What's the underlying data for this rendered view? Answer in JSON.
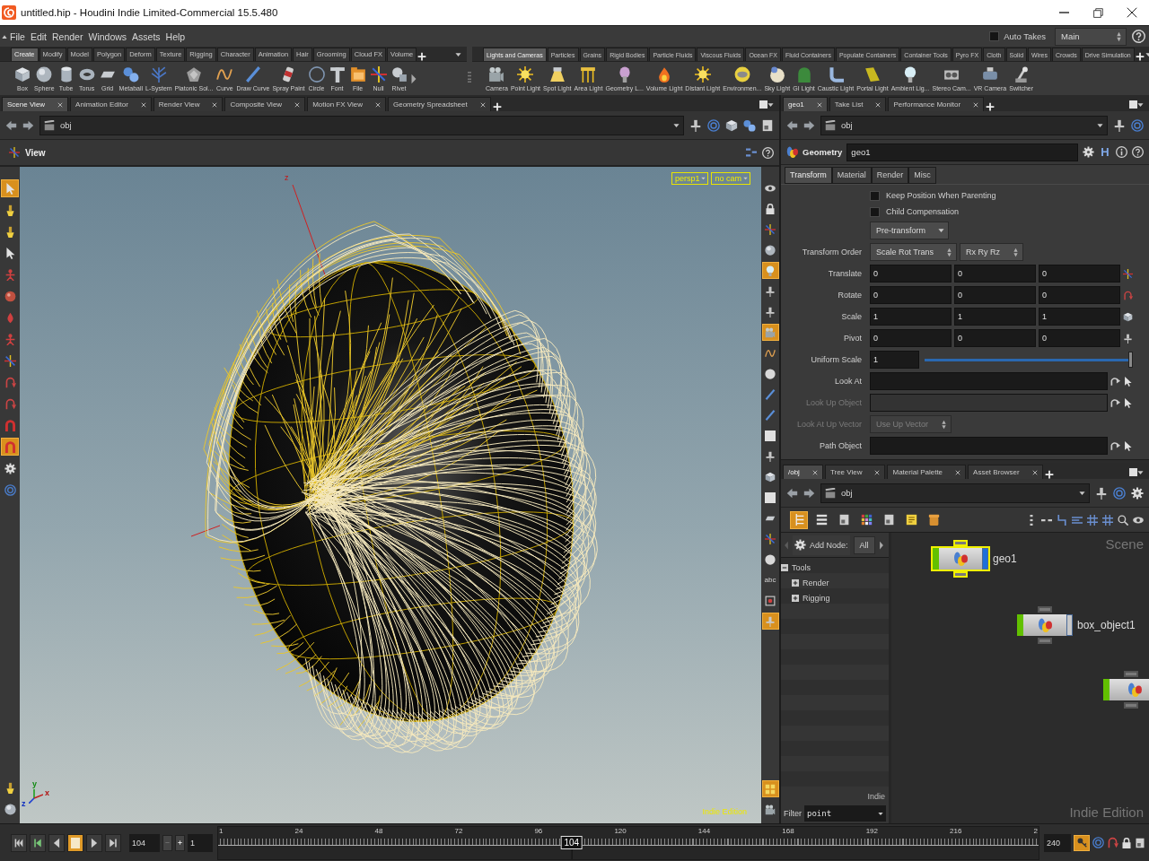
{
  "title_bar": {
    "title": "untitled.hip - Houdini Indie Limited-Commercial 15.5.480"
  },
  "menu_bar": {
    "items": [
      "File",
      "Edit",
      "Render",
      "Windows",
      "Assets",
      "Help"
    ],
    "auto_takes": {
      "label": "Auto Takes",
      "checked": false
    },
    "take": "Main"
  },
  "shelves": [
    {
      "tabs": [
        {
          "label": "Create",
          "selected": true
        },
        {
          "label": "Modify",
          "selected": false
        },
        {
          "label": "Model",
          "selected": false
        },
        {
          "label": "Polygon",
          "selected": false
        },
        {
          "label": "Deform",
          "selected": false
        },
        {
          "label": "Texture",
          "selected": false
        },
        {
          "label": "Rigging",
          "selected": false
        },
        {
          "label": "Character",
          "selected": false
        },
        {
          "label": "Animation",
          "selected": false
        },
        {
          "label": "Hair",
          "selected": false
        },
        {
          "label": "Grooming",
          "selected": false
        },
        {
          "label": "Cloud FX",
          "selected": false
        },
        {
          "label": "Volume",
          "selected": false
        }
      ],
      "tools": [
        "Box",
        "Sphere",
        "Tube",
        "Torus",
        "Grid",
        "Metaball",
        "L-System",
        "Platonic Sol...",
        "Curve",
        "Draw Curve",
        "Spray Paint",
        "Circle",
        "Font",
        "File",
        "Null",
        "Rivet"
      ]
    },
    {
      "tabs": [
        {
          "label": "Lights and Cameras",
          "selected": true
        },
        {
          "label": "Particles",
          "selected": false
        },
        {
          "label": "Grains",
          "selected": false
        },
        {
          "label": "Rigid Bodies",
          "selected": false
        },
        {
          "label": "Particle Fluids",
          "selected": false
        },
        {
          "label": "Viscous Fluids",
          "selected": false
        },
        {
          "label": "Ocean FX",
          "selected": false
        },
        {
          "label": "Fluid Containers",
          "selected": false
        },
        {
          "label": "Populate Containers",
          "selected": false
        },
        {
          "label": "Container Tools",
          "selected": false
        },
        {
          "label": "Pyro FX",
          "selected": false
        },
        {
          "label": "Cloth",
          "selected": false
        },
        {
          "label": "Solid",
          "selected": false
        },
        {
          "label": "Wires",
          "selected": false
        },
        {
          "label": "Crowds",
          "selected": false
        },
        {
          "label": "Drive Simulation",
          "selected": false
        }
      ],
      "tools": [
        "Camera",
        "Point Light",
        "Spot Light",
        "Area Light",
        "Geometry L...",
        "Volume Light",
        "Distant Light",
        "Environmen...",
        "Sky Light",
        "GI Light",
        "Caustic Light",
        "Portal Light",
        "Ambient Lig...",
        "Stereo Cam...",
        "VR Camera",
        "Switcher"
      ]
    }
  ],
  "scene_pane": {
    "tabs": [
      {
        "label": "Scene View",
        "selected": true
      },
      {
        "label": "Animation Editor",
        "selected": false
      },
      {
        "label": "Render View",
        "selected": false
      },
      {
        "label": "Composite View",
        "selected": false
      },
      {
        "label": "Motion FX View",
        "selected": false
      },
      {
        "label": "Geometry Spreadsheet",
        "selected": false
      }
    ],
    "path": "obj",
    "viewer_title": "View"
  },
  "viewport": {
    "camera_menus": [
      "persp1",
      "no cam"
    ],
    "handle_labels": [
      "z"
    ],
    "axes": [
      "y",
      "x",
      "z"
    ],
    "edition_label": "Indie Edition",
    "left_tools": [
      {
        "on": true
      },
      {
        "on": false
      },
      {
        "on": false
      },
      {
        "on": false
      },
      {
        "on": false
      },
      {
        "on": false
      },
      {
        "on": false
      },
      {
        "on": false
      },
      {
        "on": false
      },
      {
        "on": false
      },
      {
        "on": false
      },
      {
        "on": false
      },
      {
        "on": true
      },
      {
        "on": false
      },
      {
        "on": false
      }
    ],
    "left_tools_bottom": [
      {
        "on": false
      },
      {
        "on": false
      }
    ],
    "right_tools": [
      {
        "kind": "icon",
        "on": false
      },
      {
        "kind": "icon",
        "on": false
      },
      {
        "kind": "icon",
        "on": false
      },
      {
        "kind": "icon",
        "on": false
      },
      {
        "kind": "icon",
        "on": true
      },
      {
        "kind": "icon",
        "on": false
      },
      {
        "kind": "icon",
        "on": false
      },
      {
        "kind": "icon",
        "on": true
      },
      {
        "kind": "icon",
        "on": false
      },
      {
        "kind": "icon",
        "on": false
      },
      {
        "kind": "icon",
        "on": false
      },
      {
        "kind": "icon",
        "on": false
      },
      {
        "kind": "icon",
        "on": false
      },
      {
        "kind": "icon",
        "on": false
      },
      {
        "kind": "icon",
        "on": false
      },
      {
        "kind": "icon",
        "on": false
      },
      {
        "kind": "icon",
        "on": false
      },
      {
        "kind": "icon",
        "on": false
      },
      {
        "kind": "icon",
        "on": false
      },
      {
        "kind": "text",
        "label": "abc",
        "on": false
      },
      {
        "kind": "icon",
        "on": false
      },
      {
        "kind": "icon",
        "on": true
      }
    ],
    "right_tools_bottom": [
      {
        "on": true
      },
      {
        "on": false
      }
    ]
  },
  "parameter_pane": {
    "tabs": [
      {
        "label": "geo1",
        "selected": true
      },
      {
        "label": "Take List",
        "selected": false
      },
      {
        "label": "Performance Monitor",
        "selected": false
      }
    ],
    "path": "obj",
    "node_type": "Geometry",
    "node_name": "geo1",
    "asset_button": "H",
    "param_tabs": [
      {
        "label": "Transform",
        "selected": true
      },
      {
        "label": "Material",
        "selected": false
      },
      {
        "label": "Render",
        "selected": false
      },
      {
        "label": "Misc",
        "selected": false
      }
    ],
    "rows": [
      {
        "kind": "checkbox",
        "label": "Keep Position When Parenting",
        "checked": false,
        "disabled": false
      },
      {
        "kind": "checkbox",
        "label": "Child Compensation",
        "checked": false,
        "disabled": false
      },
      {
        "kind": "menu",
        "options": [
          "Pre-transform"
        ],
        "disabled": false
      },
      {
        "kind": "menu",
        "label": "Transform Order",
        "options": [
          "Scale Rot Trans",
          "Rx Ry Rz"
        ],
        "disabled": false
      },
      {
        "kind": "vector",
        "label": "Translate",
        "values": [
          "0",
          "0",
          "0"
        ],
        "disabled": false
      },
      {
        "kind": "vector",
        "label": "Rotate",
        "values": [
          "0",
          "0",
          "0"
        ],
        "disabled": false
      },
      {
        "kind": "vector",
        "label": "Scale",
        "values": [
          "1",
          "1",
          "1"
        ],
        "disabled": false
      },
      {
        "kind": "vector",
        "label": "Pivot",
        "values": [
          "0",
          "0",
          "0"
        ],
        "disabled": false
      },
      {
        "kind": "slider",
        "label": "Uniform Scale",
        "value": "1",
        "level": 1,
        "disabled": false
      },
      {
        "kind": "field",
        "label": "Look At",
        "disabled": false
      },
      {
        "kind": "field",
        "label": "Look Up Object",
        "disabled": true
      },
      {
        "kind": "menu",
        "label": "Look At Up Vector",
        "options": [
          "Use Up Vector"
        ],
        "disabled": true
      },
      {
        "kind": "field",
        "label": "Path Object",
        "disabled": false
      }
    ]
  },
  "network_pane": {
    "tabs": [
      {
        "label": "/obj",
        "selected": true
      },
      {
        "label": "Tree View",
        "selected": false
      },
      {
        "label": "Material Palette",
        "selected": false
      },
      {
        "label": "Asset Browser",
        "selected": false
      }
    ],
    "path": "obj",
    "view_modes": [
      {
        "selected": true
      },
      {
        "selected": false
      },
      {
        "selected": false
      },
      {
        "selected": false
      },
      {
        "selected": false
      },
      {
        "selected": false
      },
      {
        "selected": false
      }
    ],
    "add_node": {
      "label": "Add Node:",
      "filter": "All"
    },
    "tree": [
      {
        "label": "Tools",
        "expanded": true,
        "children": [
          {
            "label": "Render",
            "expanded": false
          },
          {
            "label": "Rigging",
            "expanded": false
          }
        ]
      }
    ],
    "palette_label": "Indie",
    "filter": {
      "label": "Filter",
      "value": "point"
    },
    "context_label": "Scene",
    "edition_label": "Indie Edition",
    "nodes": [
      {
        "label": "geo1",
        "selected": true,
        "display": true
      },
      {
        "label": "box_object1",
        "selected": false,
        "display": false
      },
      {
        "selected": false
      }
    ]
  },
  "timeline": {
    "controls": [
      {
        "kind": "first",
        "selected": false
      },
      {
        "kind": "previous-key",
        "selected": false
      },
      {
        "kind": "reverse",
        "selected": false
      },
      {
        "kind": "stop",
        "selected": true
      },
      {
        "kind": "play",
        "selected": false
      },
      {
        "kind": "last",
        "selected": false
      }
    ],
    "frame": "104",
    "start": "1",
    "ticks": [
      "1",
      "24",
      "48",
      "72",
      "96",
      "120",
      "144",
      "168",
      "192",
      "216",
      "2"
    ],
    "playhead": {
      "label": "104",
      "level": 0.431
    },
    "end": "240"
  }
}
